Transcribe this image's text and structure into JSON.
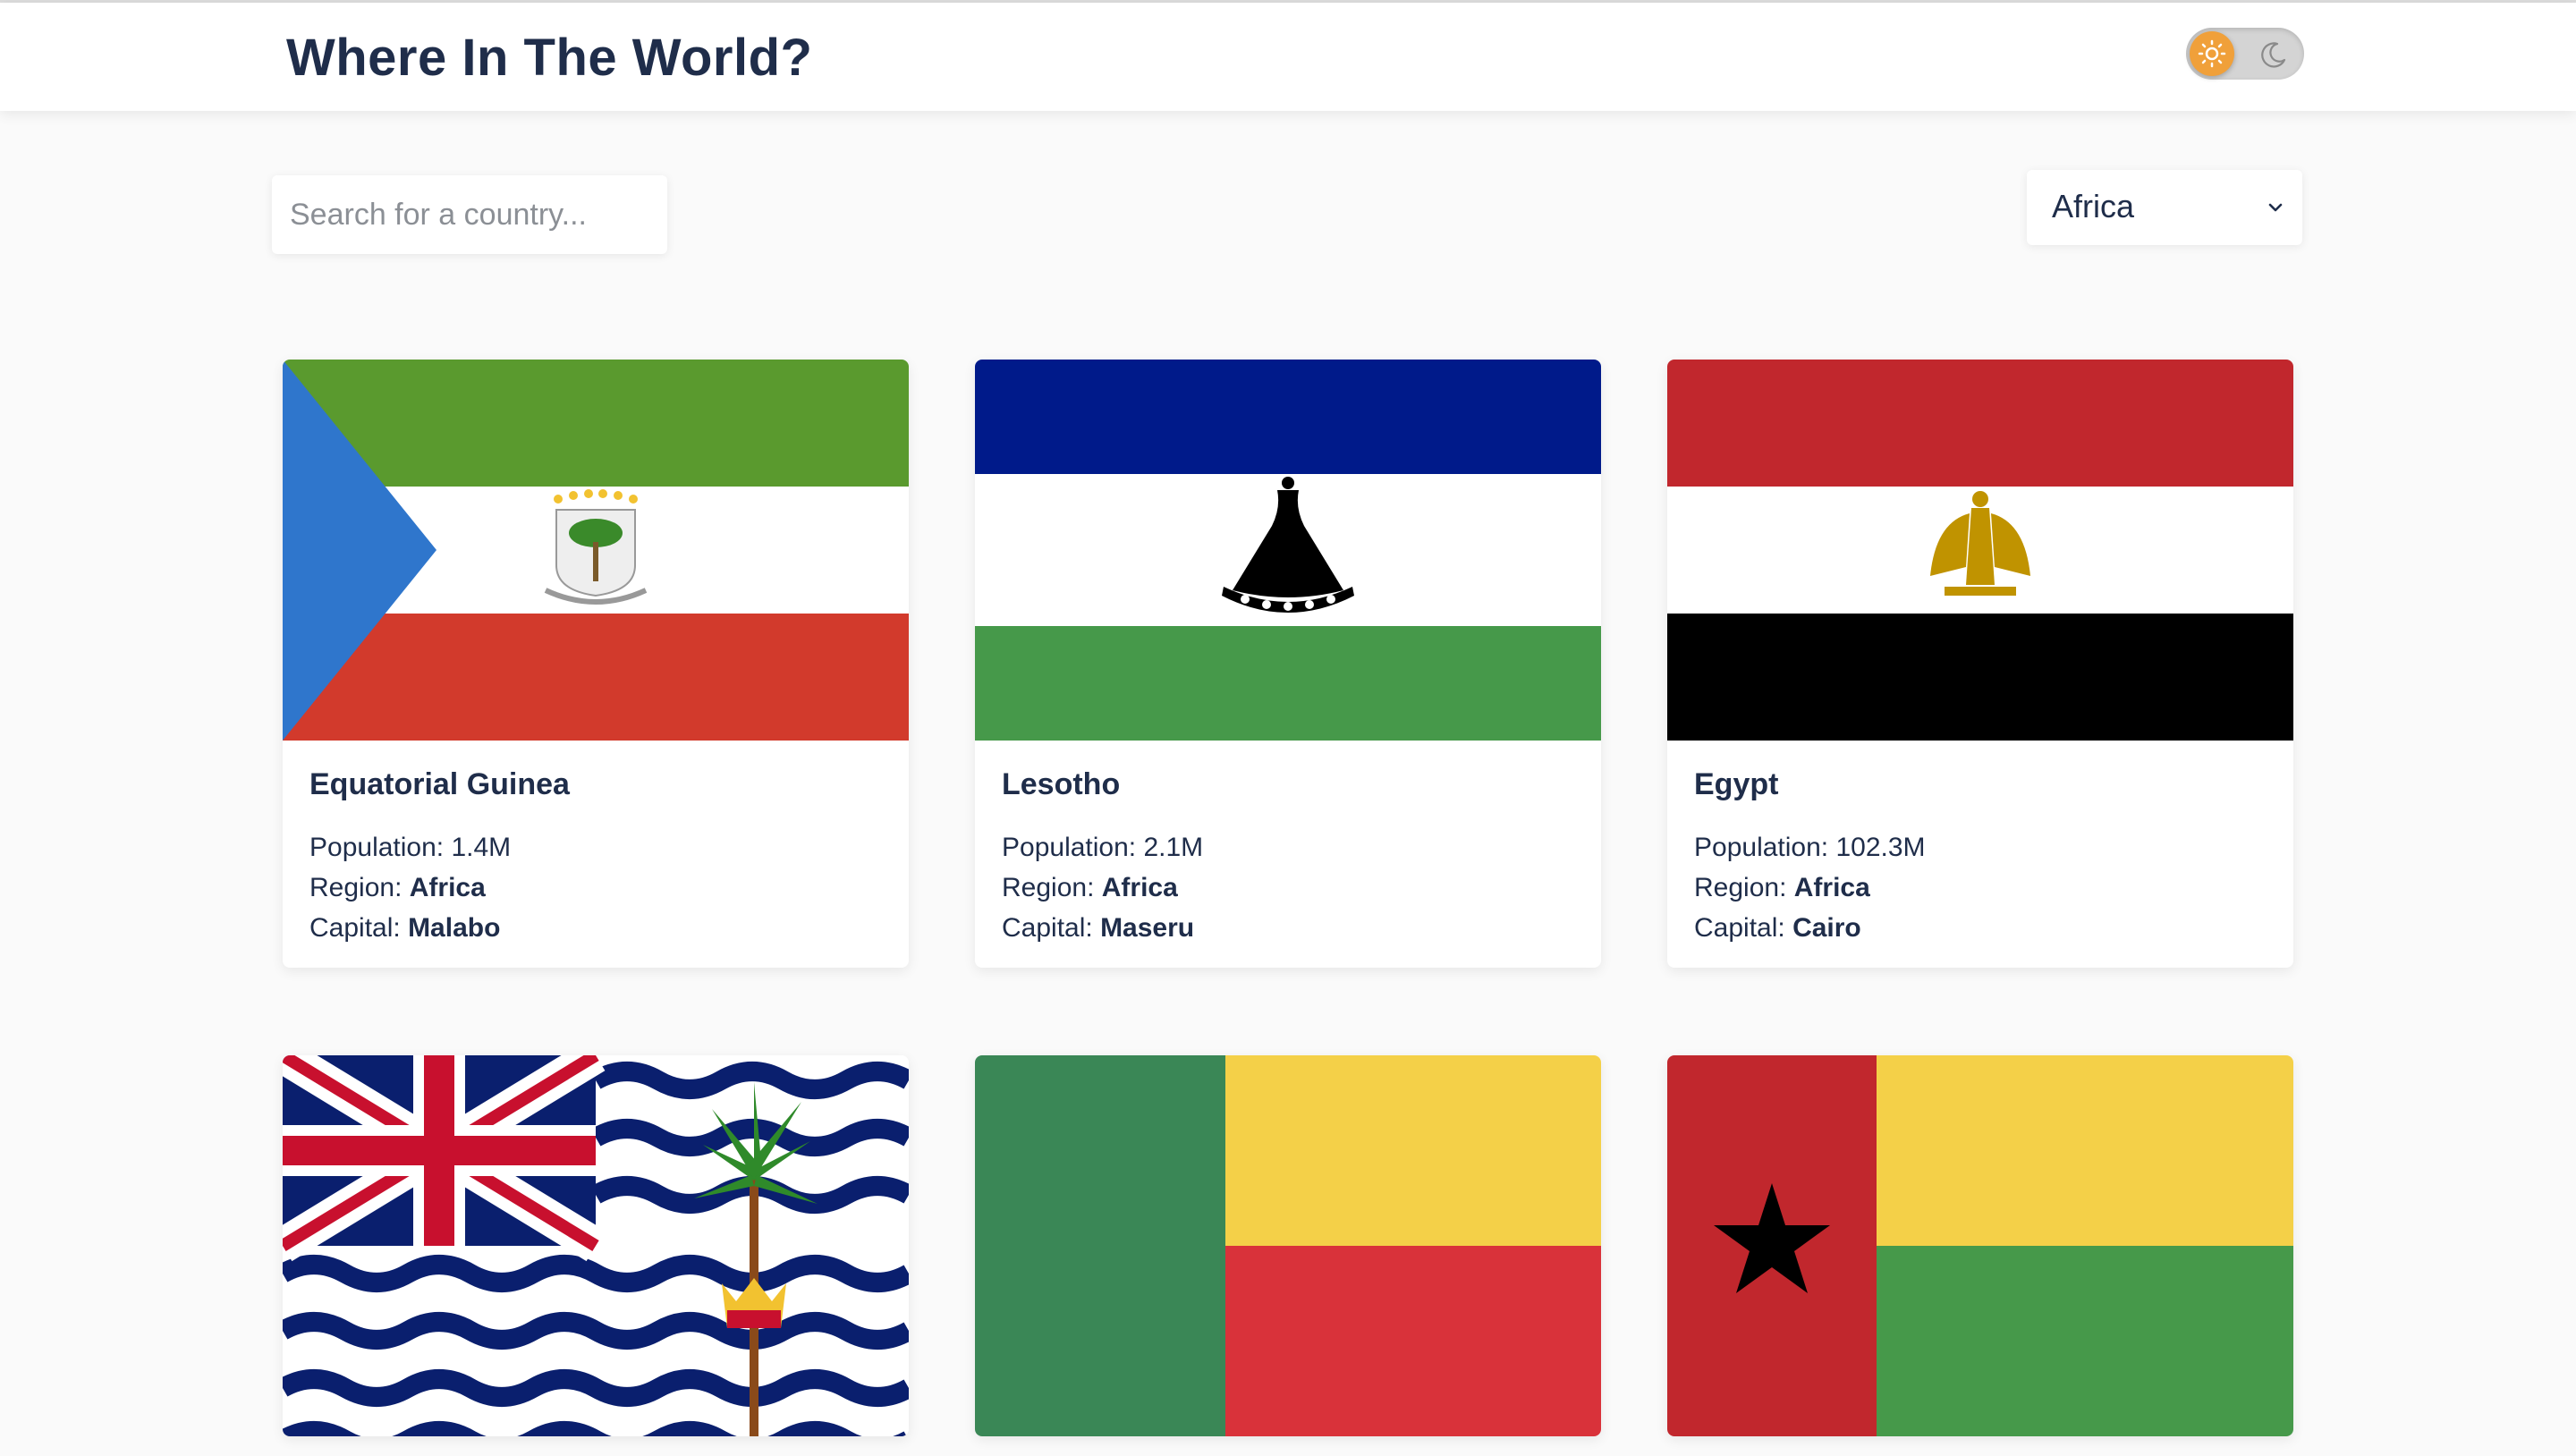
{
  "header": {
    "title": "Where In The World?"
  },
  "theme_toggle": {
    "active": "light",
    "light_icon": "sun-icon",
    "dark_icon": "moon-icon",
    "accent": "#f0a03a"
  },
  "search": {
    "placeholder": "Search for a country...",
    "value": ""
  },
  "filter": {
    "selected": "Africa"
  },
  "labels": {
    "population": "Population:",
    "region": "Region:",
    "capital": "Capital:"
  },
  "countries": [
    {
      "name": "Equatorial Guinea",
      "population": "1.4M",
      "region": "Africa",
      "capital": "Malabo",
      "flag": "equatorial-guinea"
    },
    {
      "name": "Lesotho",
      "population": "2.1M",
      "region": "Africa",
      "capital": "Maseru",
      "flag": "lesotho"
    },
    {
      "name": "Egypt",
      "population": "102.3M",
      "region": "Africa",
      "capital": "Cairo",
      "flag": "egypt"
    },
    {
      "flag": "british-indian-ocean-territory"
    },
    {
      "flag": "benin"
    },
    {
      "flag": "guinea-bissau"
    }
  ]
}
